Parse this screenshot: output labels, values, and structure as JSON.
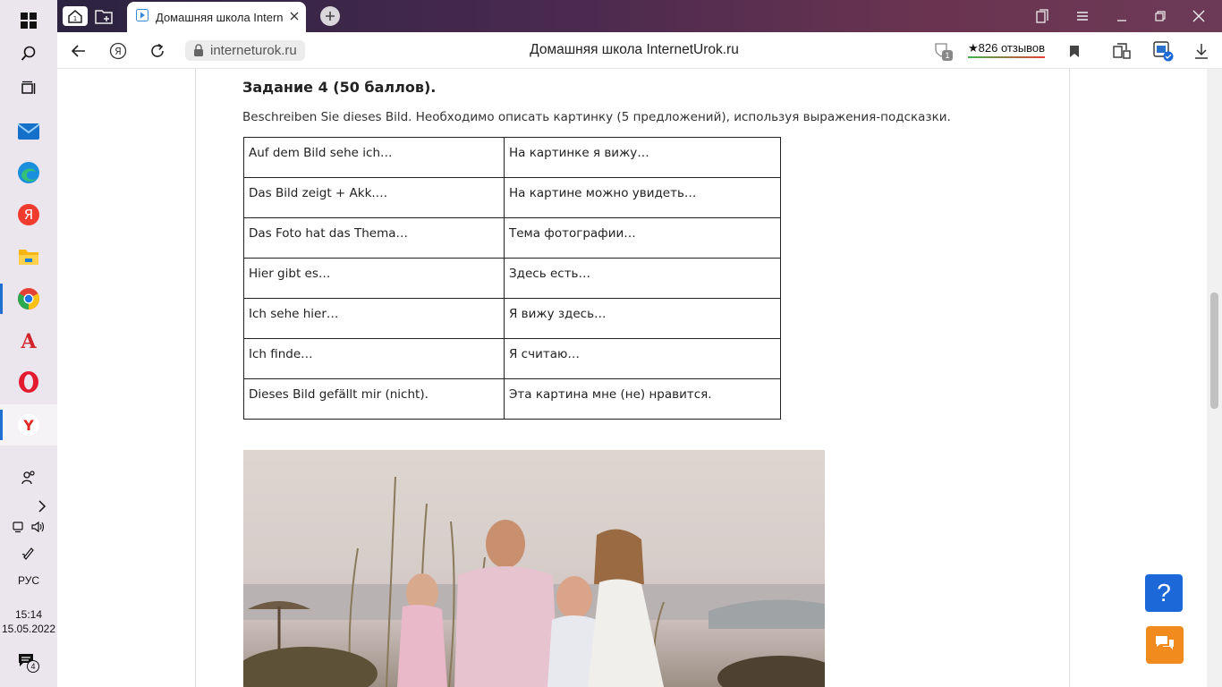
{
  "taskbar": {
    "language": "РУС",
    "time": "15:14",
    "date": "15.05.2022",
    "notifications_count": "4"
  },
  "browser": {
    "tab_title": "Домашняя школа Intern",
    "url": "interneturok.ru",
    "page_title": "Домашняя школа InternetUrok.ru",
    "reviews_label": "★826 отзывов",
    "protect_badge": "1",
    "accent_color": "#1c68d8"
  },
  "task": {
    "heading": "Задание 4 (50 баллов).",
    "description": "Beschreiben Sie dieses Bild. Необходимо описать картинку (5 предложений), используя выражения-подсказки.",
    "rows": [
      {
        "de": "Auf dem Bild sehe ich…",
        "ru": "На картинке я вижу…"
      },
      {
        "de": "Das Bild zeigt + Akk.…",
        "ru": "На картине можно увидеть…"
      },
      {
        "de": "Das Foto hat das Thema…",
        "ru": "Тема фотографии…"
      },
      {
        "de": "Hier gibt es…",
        "ru": "Здесь есть…"
      },
      {
        "de": "Ich sehe hier…",
        "ru": "Я вижу здесь…"
      },
      {
        "de": "Ich finde…",
        "ru": "Я считаю…"
      },
      {
        "de": "Dieses Bild gefällt mir (nicht).",
        "ru": "Эта картина мне (не) нравится."
      }
    ]
  },
  "widgets": {
    "help_label": "?"
  }
}
